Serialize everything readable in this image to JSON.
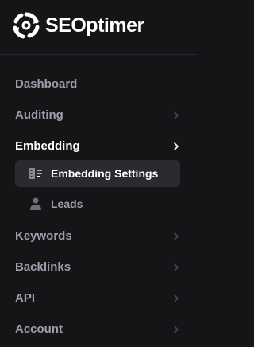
{
  "brand": {
    "name": "SEOptimer"
  },
  "nav": {
    "dashboard": "Dashboard",
    "auditing": "Auditing",
    "embedding": "Embedding",
    "embedding_settings": "Embedding Settings",
    "leads": "Leads",
    "keywords": "Keywords",
    "backlinks": "Backlinks",
    "api": "API",
    "account": "Account"
  },
  "colors": {
    "background": "#151518",
    "active_text": "#ffffff",
    "inactive_text": "#9d9ea9",
    "active_sub_bg": "#2a2b31"
  },
  "icons": {
    "logo": "gear-arrows-icon",
    "embedding_settings": "embed-settings-icon",
    "leads": "person-icon",
    "chevron": "chevron-right-icon"
  }
}
